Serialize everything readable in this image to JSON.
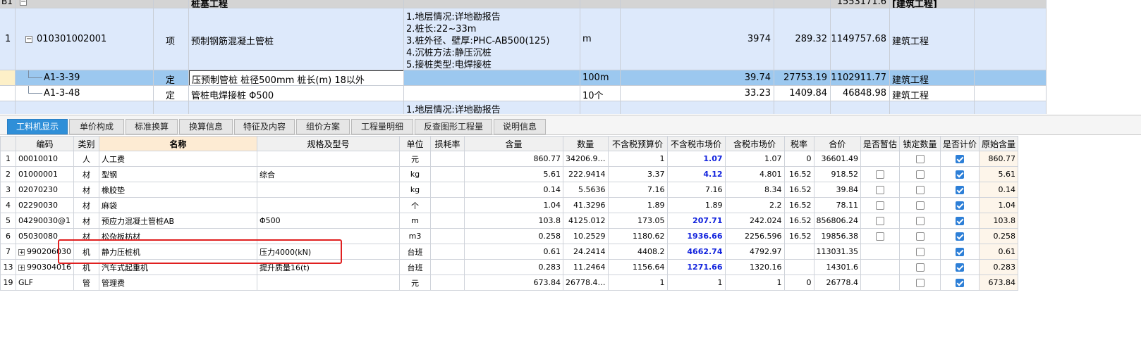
{
  "upper": {
    "header_row": {
      "num": "B1",
      "name": "桩基工程",
      "total": "1553171.6",
      "type": "[建筑工程]"
    },
    "row1": {
      "num": "1",
      "code": "010301002001",
      "kind": "项",
      "name": "预制钢筋混凝土管桩",
      "feature_lines": [
        "1.地层情况:详地勘报告",
        "2.桩长:22~33m",
        "3.桩外径、壁厚:PHC-AB500(125)",
        "4.沉桩方法:静压沉桩",
        "5.接桩类型:电焊接桩"
      ],
      "unit": "m",
      "qty": "3974",
      "price": "289.32",
      "total": "1149757.68",
      "type": "建筑工程"
    },
    "row2": {
      "code": "A1-3-39",
      "kind": "定",
      "name": "压预制管桩 桩径500mm 桩长(m) 18以外",
      "unit": "100m",
      "qty": "39.74",
      "price": "27753.19",
      "total": "1102911.77",
      "type": "建筑工程"
    },
    "row3": {
      "code": "A1-3-48",
      "kind": "定",
      "name": "管桩电焊接桩 Φ500",
      "unit": "10个",
      "qty": "33.23",
      "price": "1409.84",
      "total": "46848.98",
      "type": "建筑工程"
    },
    "row4": {
      "feature": "1.地层情况:详地勘报告"
    }
  },
  "tabs": [
    "工料机显示",
    "单价构成",
    "标准换算",
    "换算信息",
    "特征及内容",
    "组价方案",
    "工程量明细",
    "反查图形工程量",
    "说明信息"
  ],
  "columns": [
    "编码",
    "类别",
    "名称",
    "规格及型号",
    "单位",
    "损耗率",
    "含量",
    "数量",
    "不含税预算价",
    "不含税市场价",
    "含税市场价",
    "税率",
    "合价",
    "是否暂估",
    "锁定数量",
    "是否计价",
    "原始含量"
  ],
  "rows": [
    {
      "num": "1",
      "code": "00010010",
      "kind": "人",
      "name": "人工费",
      "spec": "",
      "unit": "元",
      "content": "860.77",
      "qty": "34206.9…",
      "pre_price": "1",
      "mkt_price": "1.07",
      "tax_price": "1.07",
      "tax": "0",
      "total": "36601.49",
      "est": null,
      "lock": false,
      "priced": true,
      "orig": "860.77"
    },
    {
      "num": "2",
      "code": "01000001",
      "kind": "材",
      "name": "型钢",
      "spec": "综合",
      "unit": "kg",
      "content": "5.61",
      "qty": "222.9414",
      "pre_price": "3.37",
      "mkt_price": "4.12",
      "tax_price": "4.801",
      "tax": "16.52",
      "total": "918.52",
      "est": false,
      "lock": false,
      "priced": true,
      "orig": "5.61"
    },
    {
      "num": "3",
      "code": "02070230",
      "kind": "材",
      "name": "橡胶垫",
      "spec": "",
      "unit": "kg",
      "content": "0.14",
      "qty": "5.5636",
      "pre_price": "7.16",
      "mkt_price": "7.16",
      "tax_price": "8.34",
      "tax": "16.52",
      "total": "39.84",
      "est": false,
      "lock": false,
      "priced": true,
      "orig": "0.14"
    },
    {
      "num": "4",
      "code": "02290030",
      "kind": "材",
      "name": "麻袋",
      "spec": "",
      "unit": "个",
      "content": "1.04",
      "qty": "41.3296",
      "pre_price": "1.89",
      "mkt_price": "1.89",
      "tax_price": "2.2",
      "tax": "16.52",
      "total": "78.11",
      "est": false,
      "lock": false,
      "priced": true,
      "orig": "1.04"
    },
    {
      "num": "5",
      "code": "04290030@1",
      "kind": "材",
      "name": "预应力混凝土管桩AB",
      "spec": "Φ500",
      "unit": "m",
      "content": "103.8",
      "qty": "4125.012",
      "pre_price": "173.05",
      "mkt_price": "207.71",
      "tax_price": "242.024",
      "tax": "16.52",
      "total": "856806.24",
      "est": false,
      "lock": false,
      "priced": true,
      "orig": "103.8"
    },
    {
      "num": "6",
      "code": "05030080",
      "kind": "材",
      "name": "松杂板枋材",
      "spec": "",
      "unit": "m3",
      "content": "0.258",
      "qty": "10.2529",
      "pre_price": "1180.62",
      "mkt_price": "1936.66",
      "tax_price": "2256.596",
      "tax": "16.52",
      "total": "19856.38",
      "est": false,
      "lock": false,
      "priced": true,
      "orig": "0.258"
    },
    {
      "num": "7",
      "code": "990206030",
      "kind": "机",
      "name": "静力压桩机",
      "spec": "压力4000(kN)",
      "unit": "台班",
      "content": "0.61",
      "qty": "24.2414",
      "pre_price": "4408.2",
      "mkt_price": "4662.74",
      "tax_price": "4792.97",
      "tax": "",
      "total": "113031.35",
      "est": null,
      "lock": false,
      "priced": true,
      "orig": "0.61",
      "expand": true
    },
    {
      "num": "13",
      "code": "990304016",
      "kind": "机",
      "name": "汽车式起重机",
      "spec": "提升质量16(t)",
      "unit": "台班",
      "content": "0.283",
      "qty": "11.2464",
      "pre_price": "1156.64",
      "mkt_price": "1271.66",
      "tax_price": "1320.16",
      "tax": "",
      "total": "14301.6",
      "est": null,
      "lock": false,
      "priced": true,
      "orig": "0.283",
      "expand": true
    },
    {
      "num": "19",
      "code": "GLF",
      "kind": "管",
      "name": "管理费",
      "spec": "",
      "unit": "元",
      "content": "673.84",
      "qty": "26778.4…",
      "pre_price": "1",
      "mkt_price": "1",
      "tax_price": "1",
      "tax": "0",
      "total": "26778.4",
      "est": null,
      "lock": false,
      "priced": true,
      "orig": "673.84"
    }
  ],
  "blue_market": [
    "1",
    "2",
    "5",
    "6",
    "7",
    "13"
  ]
}
